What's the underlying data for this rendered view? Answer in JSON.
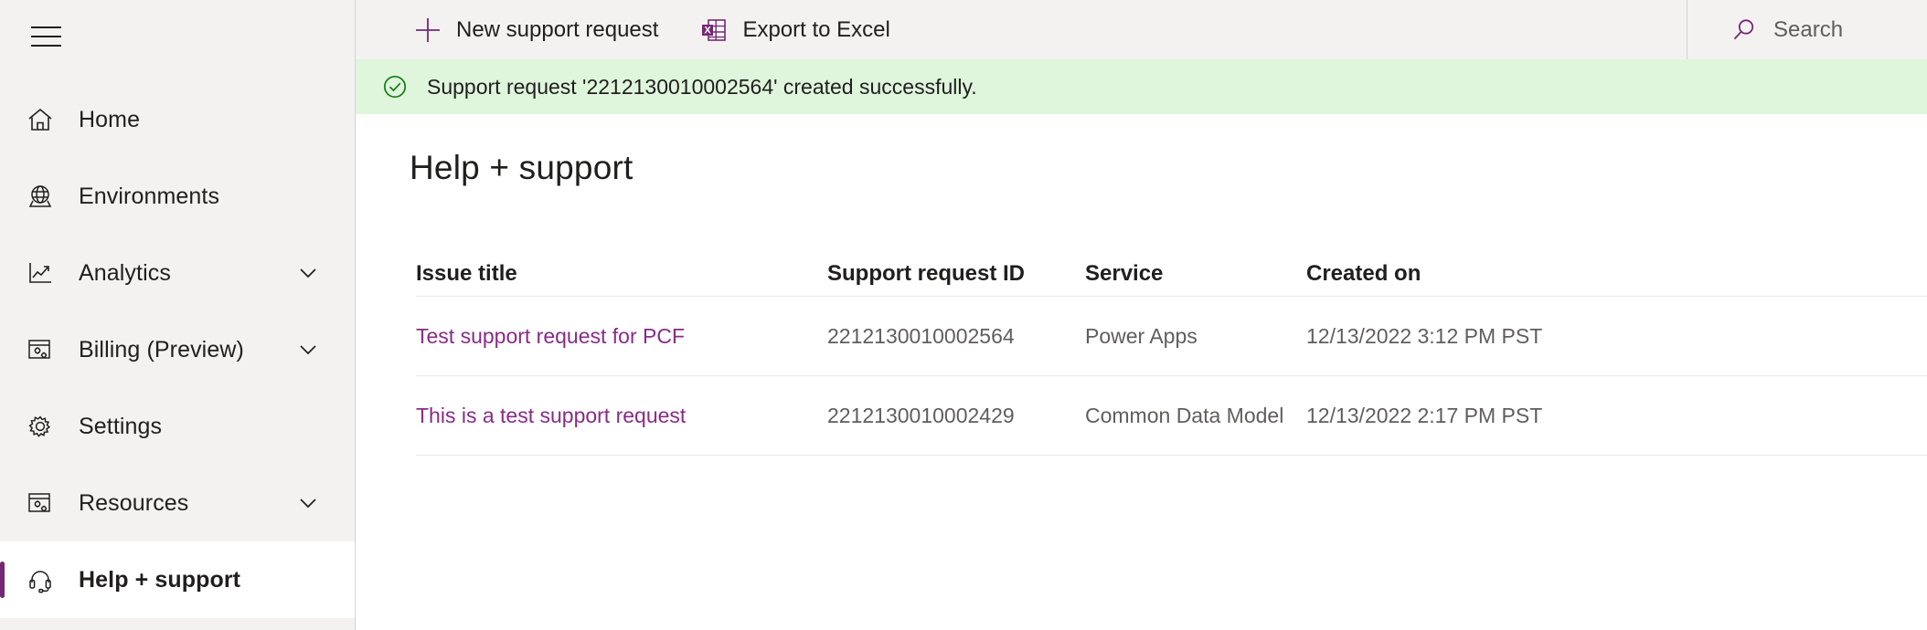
{
  "sidebar": {
    "menu_toggle": "hamburger-menu",
    "items": [
      {
        "label": "Home",
        "icon": "home-icon",
        "expandable": false,
        "selected": false
      },
      {
        "label": "Environments",
        "icon": "globe-icon",
        "expandable": false,
        "selected": false
      },
      {
        "label": "Analytics",
        "icon": "line-chart-icon",
        "expandable": true,
        "selected": false
      },
      {
        "label": "Billing (Preview)",
        "icon": "billing-icon",
        "expandable": true,
        "selected": false
      },
      {
        "label": "Settings",
        "icon": "gear-icon",
        "expandable": false,
        "selected": false
      },
      {
        "label": "Resources",
        "icon": "resources-icon",
        "expandable": true,
        "selected": false
      },
      {
        "label": "Help + support",
        "icon": "headset-icon",
        "expandable": false,
        "selected": true
      }
    ]
  },
  "toolbar": {
    "commands": [
      {
        "label": "New support request",
        "icon": "plus-icon"
      },
      {
        "label": "Export to Excel",
        "icon": "excel-icon"
      }
    ]
  },
  "search": {
    "placeholder": "Search",
    "value": "",
    "icon": "search-icon"
  },
  "banner": {
    "icon": "check-circle-icon",
    "message": "Support request '2212130010002564' created successfully.",
    "background": "#dff6dd",
    "icon_color": "#107c10"
  },
  "page": {
    "title": "Help + support"
  },
  "table": {
    "columns": [
      "Issue title",
      "Support request ID",
      "Service",
      "Created on"
    ],
    "rows": [
      {
        "issue_title": "Test support request for PCF",
        "support_request_id": "2212130010002564",
        "service": "Power Apps",
        "created_on": "12/13/2022 3:12 PM PST"
      },
      {
        "issue_title": "This is a test support request",
        "support_request_id": "2212130010002429",
        "service": "Common Data Model",
        "created_on": "12/13/2022 2:17 PM PST"
      }
    ]
  },
  "colors": {
    "accent": "#742774",
    "link": "#8a2a8a",
    "sidebar_bg": "#f3f2f1",
    "success_bg": "#dff6dd",
    "success_fg": "#107c10"
  }
}
